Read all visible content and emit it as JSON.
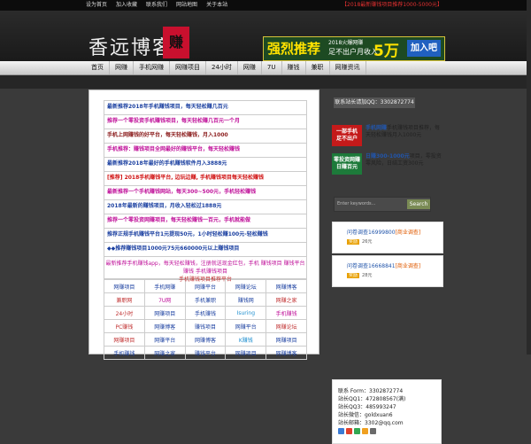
{
  "topbar": {
    "links": [
      "设为首页",
      "加入收藏",
      "联系我们",
      "网站地图",
      "关于本站"
    ],
    "notice": "【2018最新赚钱项目推荐1000-5000元】"
  },
  "logo": {
    "text": "香远博客",
    "seal": "赚"
  },
  "banner": {
    "b1": "强烈推荐",
    "b2": "2018火爆网赚",
    "b3": "足不出户月收入",
    "b4": "5万",
    "b5": "加入吧"
  },
  "nav": [
    "首页",
    "网赚",
    "手机网赚",
    "网赚项目",
    "24小时",
    "网赚",
    "7U",
    "赚钱",
    "兼职",
    "网赚资讯"
  ],
  "ads": [
    {
      "text": "最新推荐2018年手机赚钱项目，每天轻松赚几百元",
      "color": "#1a3fa0"
    },
    {
      "text": "推荐一个零投资手机赚钱项目，每天轻松赚几百元一个月",
      "color": "#c0129a"
    },
    {
      "text": "手机上网赚钱的好平台，每天轻松赚钱，月入1000",
      "color": "#8a1a1a"
    },
    {
      "text": "手机推荐：赚钱项目全网最好的赚钱平台，每天轻松赚钱",
      "color": "#c0129a"
    },
    {
      "text": "最新推荐2018年最好的手机赚钱软件月入3888元",
      "color": "#1a3fa0"
    },
    {
      "text": "[推荐] 2018手机赚钱平台, 边玩边赚, 手机赚钱项目每天轻松赚钱",
      "color": "#d01010"
    },
    {
      "text": "最新推荐一个手机赚钱网站，每天300~500元，手机轻松赚钱",
      "color": "#c0129a"
    },
    {
      "text": "2018年最新的赚钱项目，月收入轻松过1888元",
      "color": "#1a3fa0"
    },
    {
      "text": "推荐一个零投资网赚项目，每天轻松赚钱一百元，手机就能做",
      "color": "#c0129a"
    },
    {
      "text": "推荐正规手机赚钱平台1元提现50元，1小时轻松赚100元-轻松赚钱",
      "color": "#1a3fa0"
    },
    {
      "text": "◆◆推荐赚钱项目1000元75元660000元以上赚钱项目",
      "color": "#1a3fa0"
    }
  ],
  "big_ad": {
    "line1": "最新推荐手机赚钱app，每天轻松赚钱，注册就送现金红包，手机 赚钱项目 赚钱平台 赚钱 手机赚钱项目",
    "line2": "手机赚钱项目推荐平台"
  },
  "grid": [
    [
      {
        "t": "网赚项目",
        "c": "#1a3fa0"
      },
      {
        "t": "手机网赚",
        "c": "#1a3fa0"
      },
      {
        "t": "网赚平台",
        "c": "#1a3fa0"
      },
      {
        "t": "网赚论坛",
        "c": "#1a3fa0"
      },
      {
        "t": "网赚博客",
        "c": "#1a3fa0"
      }
    ],
    [
      {
        "t": "兼职网",
        "c": "#c03030"
      },
      {
        "t": "7U网",
        "c": "#c0129a"
      },
      {
        "t": "手机兼职",
        "c": "#1a3fa0"
      },
      {
        "t": "赚钱网",
        "c": "#1a3fa0"
      },
      {
        "t": "网赚之家",
        "c": "#c03030"
      }
    ],
    [
      {
        "t": "24小时",
        "c": "#c03030"
      },
      {
        "t": "网赚项目",
        "c": "#1a3fa0"
      },
      {
        "t": "手机赚钱",
        "c": "#1a3fa0"
      },
      {
        "t": "Isuring",
        "c": "#2090d0"
      },
      {
        "t": "手机赚钱",
        "c": "#c0129a"
      }
    ],
    [
      {
        "t": "PC赚钱",
        "c": "#c03030"
      },
      {
        "t": "网赚博客",
        "c": "#1a3fa0"
      },
      {
        "t": "赚钱项目",
        "c": "#1a3fa0"
      },
      {
        "t": "网赚平台",
        "c": "#1a3fa0"
      },
      {
        "t": "网赚论坛",
        "c": "#c03030"
      }
    ],
    [
      {
        "t": "网赚项目",
        "c": "#c03030"
      },
      {
        "t": "网赚平台",
        "c": "#1a3fa0"
      },
      {
        "t": "网赚博客",
        "c": "#1a3fa0"
      },
      {
        "t": "K赚钱",
        "c": "#2090d0"
      },
      {
        "t": "网赚项目",
        "c": "#1a3fa0"
      }
    ],
    [
      {
        "t": "手机赚钱",
        "c": "#1a3fa0"
      },
      {
        "t": "网赚之家",
        "c": "#1a3fa0"
      },
      {
        "t": "赚钱平台",
        "c": "#1a3fa0"
      },
      {
        "t": "网赚项目",
        "c": "#1a3fa0"
      },
      {
        "t": "网赚博客",
        "c": "#1a3fa0"
      }
    ]
  ],
  "sidebar": {
    "qq": "联系站长请加QQ：3302872774",
    "promo1": {
      "img": "一部手机\n足不出户",
      "title": "手机网赚",
      "text": "手机赚钱项目推荐，每天轻松赚钱月入1000元"
    },
    "promo2": {
      "img": "零投资网赚\n日赚百元",
      "title": "日赚300-1000元",
      "text": "项目，零投资零风险，日结工资300元"
    },
    "search_placeholder": "Enter keywords...",
    "search_button": "Search",
    "surveys": [
      {
        "title": "问卷调查16999800",
        "tag": "[商业调查]",
        "reward_label": "奖励",
        "reward": "26元"
      },
      {
        "title": "问卷调查16668841",
        "tag": "[商业调查]",
        "reward_label": "奖励",
        "reward": "28元"
      }
    ],
    "contact": [
      "联系 Form：3302872774",
      "站长QQ1：472808567(满)",
      "站长QQ3：485993247",
      "站长微信：goldxuan6",
      "站长邮箱：3302@qq.com"
    ]
  }
}
